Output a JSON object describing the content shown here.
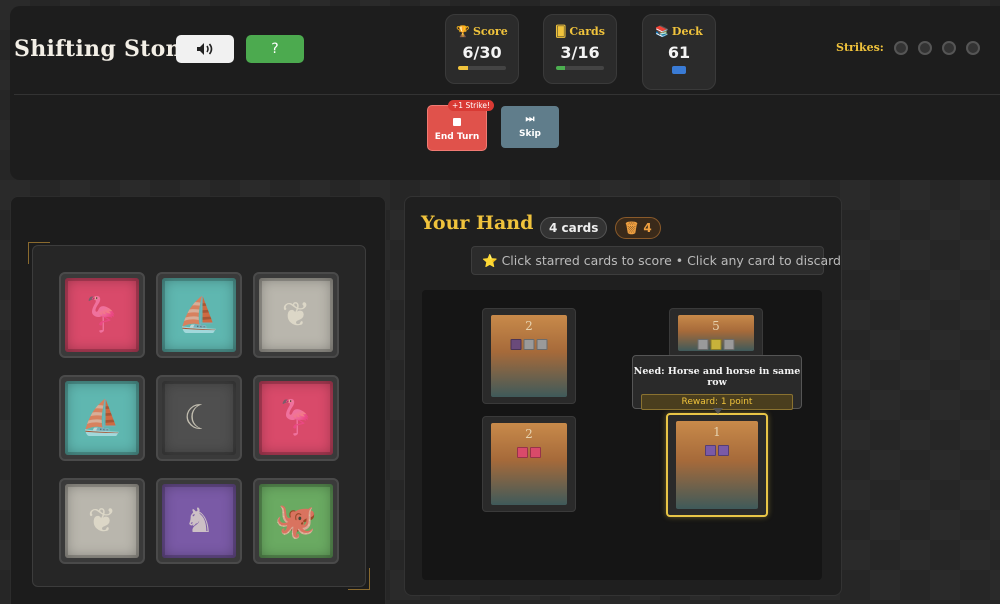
{
  "header": {
    "title": "Shifting Stones",
    "help_label": "?"
  },
  "stats": {
    "score": {
      "label": "Score",
      "value": "6/30",
      "progress": 0.2
    },
    "cards": {
      "label": "Cards",
      "value": "3/16",
      "progress": 0.19
    },
    "deck": {
      "label": "Deck",
      "value": "61"
    }
  },
  "strikes": {
    "label": "Strikes:",
    "count": 0,
    "max": 4
  },
  "actions": {
    "end_turn_label": "End Turn",
    "end_turn_badge": "+1 Strike!",
    "skip_label": "Skip"
  },
  "board": {
    "tiles": [
      {
        "type": "flamingo",
        "color": "#d94a6a"
      },
      {
        "type": "ship",
        "color": "#5fb7b0"
      },
      {
        "type": "leaf",
        "color": "#b9b6ad"
      },
      {
        "type": "ship",
        "color": "#5fb7b0"
      },
      {
        "type": "moon",
        "color": "#4f4f4f"
      },
      {
        "type": "flamingo",
        "color": "#d94a6a"
      },
      {
        "type": "leaf",
        "color": "#b9b6ad"
      },
      {
        "type": "horse",
        "color": "#7a5aa6"
      },
      {
        "type": "octopus",
        "color": "#6aaa62"
      }
    ]
  },
  "hand": {
    "title": "Your Hand",
    "count_label": "4 cards",
    "discard_count": "4",
    "hint": "Click starred cards to score • Click any card to discard",
    "cards": [
      {
        "points": "2",
        "req_colors": [
          "#6a4a7a",
          "#9a9a9a",
          "#9a9a9a"
        ]
      },
      {
        "points": "5",
        "req_colors": [
          "#9a9a9a",
          "#c8b23a",
          "#9a9a9a"
        ]
      },
      {
        "points": "2",
        "req_colors": [
          "#d94a6a",
          "#d94a6a"
        ]
      },
      {
        "points": "1",
        "req_colors": [
          "#7a5aa6",
          "#7a5aa6"
        ]
      }
    ],
    "tooltip": {
      "need": "Need: Horse and horse in same row",
      "reward": "Reward: 1 point"
    }
  }
}
